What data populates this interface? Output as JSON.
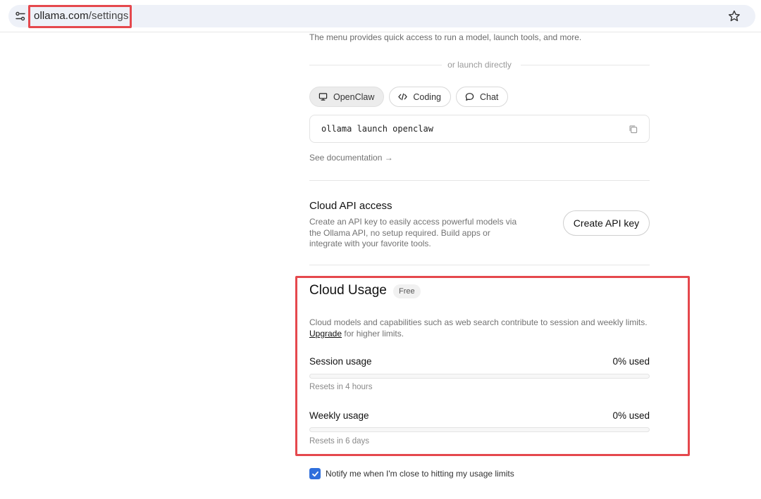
{
  "browser": {
    "url_domain": "ollama.com",
    "url_path": "/settings",
    "site_info_icon": "tune-icon",
    "bookmark_icon": "star-icon"
  },
  "launch": {
    "menu_note": "The menu provides quick access to run a model, launch tools, and more.",
    "divider_text": "or launch directly",
    "chips": [
      {
        "label": "OpenClaw",
        "icon": "monitor-icon",
        "active": true
      },
      {
        "label": "Coding",
        "icon": "code-icon",
        "active": false
      },
      {
        "label": "Chat",
        "icon": "chat-bubble-icon",
        "active": false
      }
    ],
    "command": "ollama launch openclaw",
    "copy_icon": "copy-icon",
    "doc_link": "See documentation →"
  },
  "cloud_api": {
    "title": "Cloud API access",
    "description": "Create an API key to easily access powerful models via the Ollama API, no setup required. Build apps or integrate with your favorite tools.",
    "button": "Create API key"
  },
  "cloud_usage": {
    "title": "Cloud Usage",
    "badge": "Free",
    "description_before": "Cloud models and capabilities such as web search contribute to session and weekly limits.",
    "upgrade_link": "Upgrade",
    "description_after": "for higher limits.",
    "session": {
      "label": "Session usage",
      "value": "0% used",
      "percent": 0,
      "reset": "Resets in 4 hours"
    },
    "weekly": {
      "label": "Weekly usage",
      "value": "0% used",
      "percent": 0,
      "reset": "Resets in 6 days"
    }
  },
  "notify": {
    "checked": true,
    "label": "Notify me when I'm close to hitting my usage limits"
  },
  "colors": {
    "highlight": "#e5484d",
    "checkbox": "#2f6fdc"
  }
}
